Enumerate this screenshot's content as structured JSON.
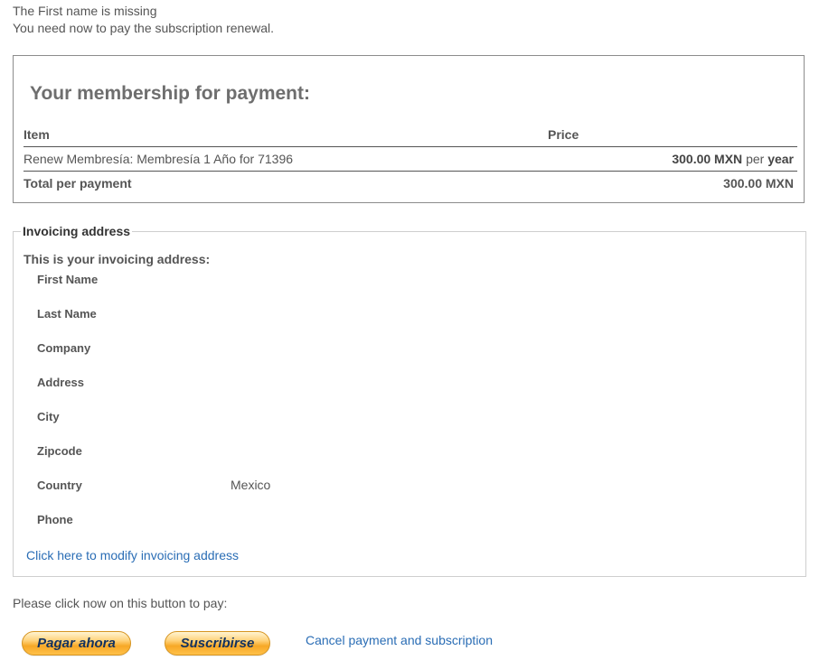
{
  "messages": {
    "line1": "The First name is missing",
    "line2": "You need now to pay the subscription renewal."
  },
  "membership": {
    "title": "Your membership for payment:",
    "headers": {
      "item": "Item",
      "price": "Price"
    },
    "row": {
      "item": "Renew Membresía: Membresía 1 Año for 71396",
      "amount": "300.00 MXN",
      "per": "per",
      "period": "year"
    },
    "total": {
      "label": "Total per payment",
      "amount": "300.00 MXN"
    }
  },
  "invoicing": {
    "legend": "Invoicing address",
    "intro": "This is your invoicing address:",
    "fields": [
      {
        "label": "First Name",
        "value": ""
      },
      {
        "label": "Last Name",
        "value": ""
      },
      {
        "label": "Company",
        "value": ""
      },
      {
        "label": "Address",
        "value": ""
      },
      {
        "label": "City",
        "value": ""
      },
      {
        "label": "Zipcode",
        "value": ""
      },
      {
        "label": "Country",
        "value": "Mexico"
      },
      {
        "label": "Phone",
        "value": ""
      }
    ],
    "modify_link": "Click here to modify invoicing address"
  },
  "payment": {
    "prompt": "Please click now on this button to pay:",
    "pay_now_button": "Pagar ahora",
    "subscribe_button": "Suscribirse",
    "cancel_link": "Cancel payment and subscription"
  }
}
